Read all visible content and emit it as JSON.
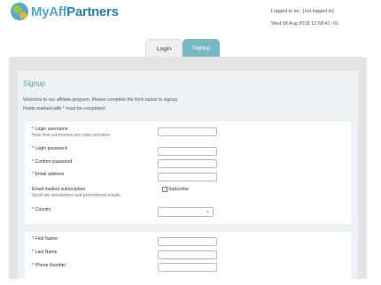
{
  "brand": {
    "name_part1": "MyAff",
    "name_part2": "Partners"
  },
  "status": {
    "logged_in": "Logged in as : [not logged in]",
    "datetime": "Wed 08 Aug 2018 12:58:41 -01"
  },
  "tabs": [
    {
      "label": "Login"
    },
    {
      "label": "Signup"
    }
  ],
  "form": {
    "title": "Signup",
    "intro_line1": "Welcome to our affiliate program. Please complete the form below to signup.",
    "intro_line2": "Fields marked with * must be completed.",
    "fields": [
      {
        "label": "* Login username",
        "hint": "Note that usernames are case sensitive."
      },
      {
        "label": "* Login password"
      },
      {
        "label": "* Confirm password"
      },
      {
        "label": "* Email address"
      },
      {
        "label": "Email mailout subscription",
        "hint": "Send me newsletters and promotional emails.",
        "checkbox_label": "Subscribe"
      },
      {
        "label": "* Country"
      },
      {
        "label": "* First Name"
      },
      {
        "label": "* Last Name"
      },
      {
        "label": "* Phone Number"
      }
    ],
    "select_chevron": "⌄"
  }
}
